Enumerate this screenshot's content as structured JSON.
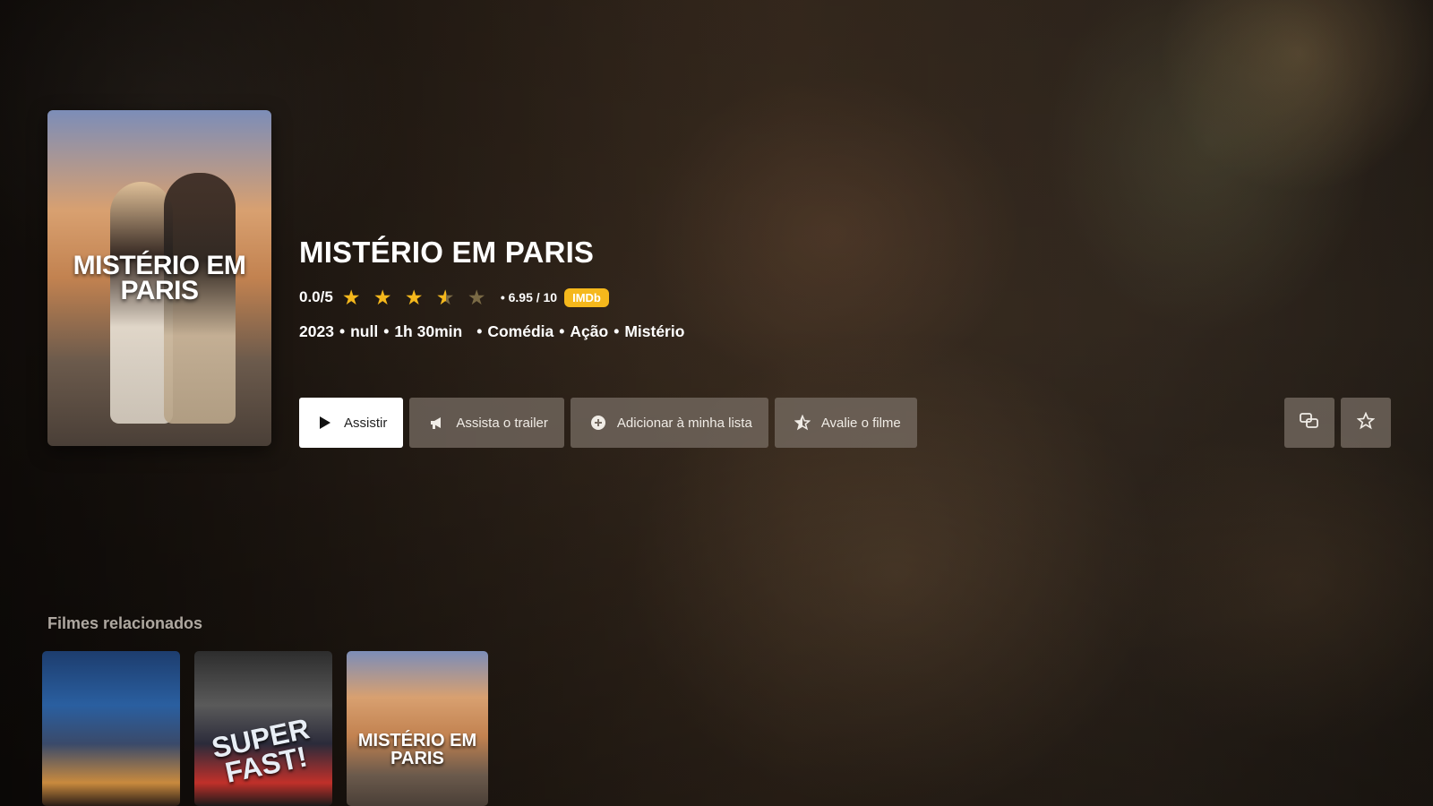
{
  "movie": {
    "title": "MISTÉRIO EM PARIS",
    "poster_title": "MISTÉRIO EM PARIS",
    "user_rating": "0.0/5",
    "stars": {
      "value": 3.5,
      "max": 5
    },
    "imdb_score": "• 6.95 / 10",
    "imdb_label": "IMDb",
    "year": "2023",
    "rating_field": "null",
    "duration": "1h 30min",
    "genres": [
      "Comédia",
      "Ação",
      "Mistério"
    ],
    "separator": "•"
  },
  "actions": {
    "watch": "Assistir",
    "trailer": "Assista o trailer",
    "add_list": "Adicionar à minha lista",
    "rate": "Avalie o filme"
  },
  "icons": {
    "play": "play-icon",
    "megaphone": "megaphone-icon",
    "plus": "plus-circle-icon",
    "star_rate": "star-rate-icon",
    "subtitles": "subtitles-icon",
    "favorite": "star-outline-icon"
  },
  "related": {
    "heading": "Filmes relacionados",
    "items": [
      {
        "title": ""
      },
      {
        "title": "SUPER FAST!"
      },
      {
        "title": "MISTÉRIO EM PARIS"
      }
    ]
  },
  "colors": {
    "accent": "#f5b81c",
    "button_bg": "#786e64",
    "primary_button_bg": "#ffffff"
  }
}
